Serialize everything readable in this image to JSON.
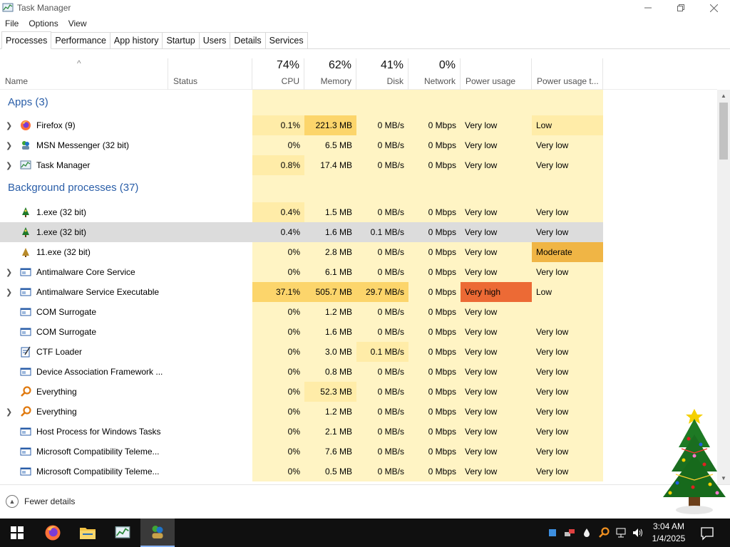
{
  "window": {
    "title": "Task Manager"
  },
  "menu": [
    "File",
    "Options",
    "View"
  ],
  "tabs": [
    "Processes",
    "Performance",
    "App history",
    "Startup",
    "Users",
    "Details",
    "Services"
  ],
  "columns": {
    "name": "Name",
    "status": "Status",
    "cpu": {
      "pct": "74%",
      "label": "CPU"
    },
    "memory": {
      "pct": "62%",
      "label": "Memory"
    },
    "disk": {
      "pct": "41%",
      "label": "Disk"
    },
    "network": {
      "pct": "0%",
      "label": "Network"
    },
    "power": "Power usage",
    "power_trend": "Power usage t..."
  },
  "groups": {
    "apps": "Apps (3)",
    "background": "Background processes (37)"
  },
  "apps": [
    {
      "name": "Firefox (9)",
      "icon": "firefox-icon",
      "cpu": "0.1%",
      "mem": "221.3 MB",
      "disk": "0 MB/s",
      "net": "0 Mbps",
      "power": "Very low",
      "trend": "Low"
    },
    {
      "name": "MSN Messenger (32 bit)",
      "icon": "msn-icon",
      "cpu": "0%",
      "mem": "6.5 MB",
      "disk": "0 MB/s",
      "net": "0 Mbps",
      "power": "Very low",
      "trend": "Very low"
    },
    {
      "name": "Task Manager",
      "icon": "task-manager-icon",
      "cpu": "0.8%",
      "mem": "17.4 MB",
      "disk": "0 MB/s",
      "net": "0 Mbps",
      "power": "Very low",
      "trend": "Very low"
    }
  ],
  "background": [
    {
      "name": "1.exe (32 bit)",
      "icon": "tree-app-icon",
      "cpu": "0.4%",
      "mem": "1.5 MB",
      "disk": "0 MB/s",
      "net": "0 Mbps",
      "power": "Very low",
      "trend": "Very low"
    },
    {
      "name": "1.exe (32 bit)",
      "icon": "tree-app-icon",
      "cpu": "0.4%",
      "mem": "1.6 MB",
      "disk": "0.1 MB/s",
      "net": "0 Mbps",
      "power": "Very low",
      "trend": "Very low"
    },
    {
      "name": "11.exe (32 bit)",
      "icon": "tree-app-icon",
      "cpu": "0%",
      "mem": "2.8 MB",
      "disk": "0 MB/s",
      "net": "0 Mbps",
      "power": "Very low",
      "trend": "Moderate"
    },
    {
      "name": "Antimalware Core Service",
      "icon": "service-icon",
      "cpu": "0%",
      "mem": "6.1 MB",
      "disk": "0 MB/s",
      "net": "0 Mbps",
      "power": "Very low",
      "trend": "Very low"
    },
    {
      "name": "Antimalware Service Executable",
      "icon": "service-icon",
      "cpu": "37.1%",
      "mem": "505.7 MB",
      "disk": "29.7 MB/s",
      "net": "0 Mbps",
      "power": "Very high",
      "trend": "Low"
    },
    {
      "name": "COM Surrogate",
      "icon": "service-icon",
      "cpu": "0%",
      "mem": "1.2 MB",
      "disk": "0 MB/s",
      "net": "0 Mbps",
      "power": "Very low",
      "trend": ""
    },
    {
      "name": "COM Surrogate",
      "icon": "service-icon",
      "cpu": "0%",
      "mem": "1.6 MB",
      "disk": "0 MB/s",
      "net": "0 Mbps",
      "power": "Very low",
      "trend": "Very low"
    },
    {
      "name": "CTF Loader",
      "icon": "ctf-loader-icon",
      "cpu": "0%",
      "mem": "3.0 MB",
      "disk": "0.1 MB/s",
      "net": "0 Mbps",
      "power": "Very low",
      "trend": "Very low"
    },
    {
      "name": "Device Association Framework ...",
      "icon": "service-icon",
      "cpu": "0%",
      "mem": "0.8 MB",
      "disk": "0 MB/s",
      "net": "0 Mbps",
      "power": "Very low",
      "trend": "Very low"
    },
    {
      "name": "Everything",
      "icon": "everything-search-icon",
      "cpu": "0%",
      "mem": "52.3 MB",
      "disk": "0 MB/s",
      "net": "0 Mbps",
      "power": "Very low",
      "trend": "Very low"
    },
    {
      "name": "Everything",
      "icon": "everything-search-icon",
      "cpu": "0%",
      "mem": "1.2 MB",
      "disk": "0 MB/s",
      "net": "0 Mbps",
      "power": "Very low",
      "trend": "Very low"
    },
    {
      "name": "Host Process for Windows Tasks",
      "icon": "service-icon",
      "cpu": "0%",
      "mem": "2.1 MB",
      "disk": "0 MB/s",
      "net": "0 Mbps",
      "power": "Very low",
      "trend": "Very low"
    },
    {
      "name": "Microsoft Compatibility Teleme...",
      "icon": "service-icon",
      "cpu": "0%",
      "mem": "7.6 MB",
      "disk": "0 MB/s",
      "net": "0 Mbps",
      "power": "Very low",
      "trend": "Very low"
    },
    {
      "name": "Microsoft Compatibility Teleme...",
      "icon": "service-icon",
      "cpu": "0%",
      "mem": "0.5 MB",
      "disk": "0 MB/s",
      "net": "0 Mbps",
      "power": "Very low",
      "trend": "Very low"
    }
  ],
  "footer": {
    "fewer_details": "Fewer details"
  },
  "taskbar": {
    "time": "3:04 AM",
    "date": "1/4/2025"
  },
  "colors": {
    "group_title": "#2a5ea8",
    "heat_light": "#fff4c4",
    "heat_mid": "#ffeca8",
    "heat_strong": "#fcd56b",
    "heat_moderate": "#f0b545",
    "heat_very_high": "#ec6a35",
    "selection": "#dcdcdc"
  }
}
